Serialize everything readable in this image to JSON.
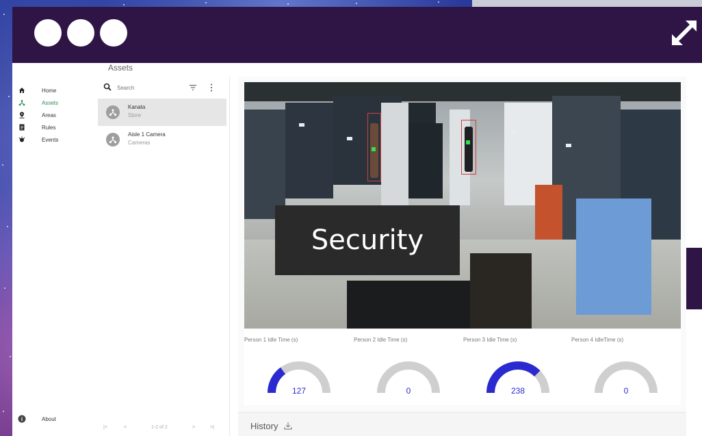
{
  "window": {
    "expand_icon": "expand-icon"
  },
  "sidebar": {
    "items": [
      {
        "label": "Home",
        "icon": "home-icon",
        "active": false
      },
      {
        "label": "Assets",
        "icon": "assets-icon",
        "active": true
      },
      {
        "label": "Areas",
        "icon": "location-icon",
        "active": false
      },
      {
        "label": "Rules",
        "icon": "rules-icon",
        "active": false
      },
      {
        "label": "Events",
        "icon": "events-icon",
        "active": false
      }
    ],
    "about_label": "About"
  },
  "assets": {
    "header": "Assets",
    "search_placeholder": "Search",
    "items": [
      {
        "title": "Kanata",
        "subtitle": "Store"
      },
      {
        "title": "Aisle 1 Camera",
        "subtitle": "Cameras"
      }
    ],
    "pager": {
      "first": "|<",
      "prev": "<",
      "range": "1-2 of 2",
      "next": ">",
      "last": ">|"
    }
  },
  "camera": {
    "overlay_text": "Security"
  },
  "gauges": [
    {
      "label": "Person 1 Idle Time (s)",
      "value": "127",
      "fill": 0.3
    },
    {
      "label": "Person 2 Idle Time (s)",
      "value": "0",
      "fill": 0.0
    },
    {
      "label": "Person 3 Idle Time (s)",
      "value": "238",
      "fill": 0.75
    },
    {
      "label": "Person 4 IdleTime (s)",
      "value": "0",
      "fill": 0.0
    }
  ],
  "history": {
    "label": "History"
  },
  "colors": {
    "accent": "#2a2ad0",
    "gauge_track": "#cfcfcf",
    "active_nav": "#2e8b57",
    "window_frame": "#2e1546"
  }
}
